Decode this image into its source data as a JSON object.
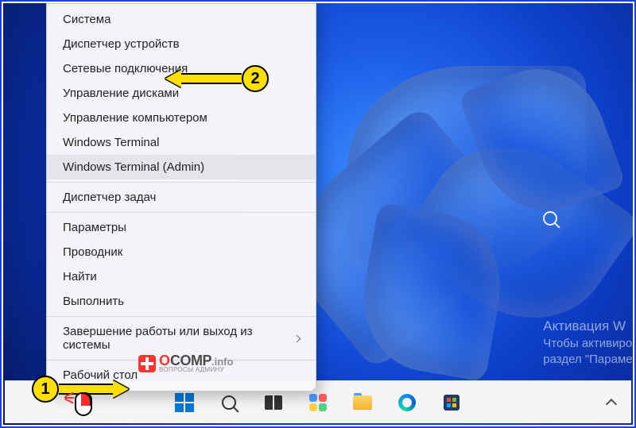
{
  "ctx_menu": {
    "items": [
      {
        "label": "Система",
        "sep": false,
        "hover": false,
        "sub": false
      },
      {
        "label": "Диспетчер устройств",
        "sep": false,
        "hover": false,
        "sub": false
      },
      {
        "label": "Сетевые подключения",
        "sep": false,
        "hover": false,
        "sub": false
      },
      {
        "label": "Управление дисками",
        "sep": false,
        "hover": false,
        "sub": false
      },
      {
        "label": "Управление компьютером",
        "sep": false,
        "hover": false,
        "sub": false
      },
      {
        "label": "Windows Terminal",
        "sep": false,
        "hover": false,
        "sub": false
      },
      {
        "label": "Windows Terminal (Admin)",
        "sep": false,
        "hover": true,
        "sub": false
      },
      {
        "sep": true
      },
      {
        "label": "Диспетчер задач",
        "sep": false,
        "hover": false,
        "sub": false
      },
      {
        "sep": true
      },
      {
        "label": "Параметры",
        "sep": false,
        "hover": false,
        "sub": false
      },
      {
        "label": "Проводник",
        "sep": false,
        "hover": false,
        "sub": false
      },
      {
        "label": "Найти",
        "sep": false,
        "hover": false,
        "sub": false
      },
      {
        "label": "Выполнить",
        "sep": false,
        "hover": false,
        "sub": false
      },
      {
        "sep": true
      },
      {
        "label": "Завершение работы или выход из системы",
        "sep": false,
        "hover": false,
        "sub": true
      },
      {
        "sep": true
      },
      {
        "label": "Рабочий стол",
        "sep": false,
        "hover": false,
        "sub": false
      }
    ]
  },
  "activation": {
    "line1": "Активация W",
    "line2": "Чтобы активиро",
    "line3": "раздел \"Парамет"
  },
  "callouts": {
    "c1": "1",
    "c2": "2"
  },
  "watermark": {
    "o": "O",
    "comp": "COMP",
    "info": ".info",
    "sub": "ВОПРОСЫ АДМИНУ"
  },
  "taskbar": {
    "items": [
      "start",
      "search",
      "taskview",
      "widgets",
      "explorer",
      "edge",
      "store"
    ]
  }
}
